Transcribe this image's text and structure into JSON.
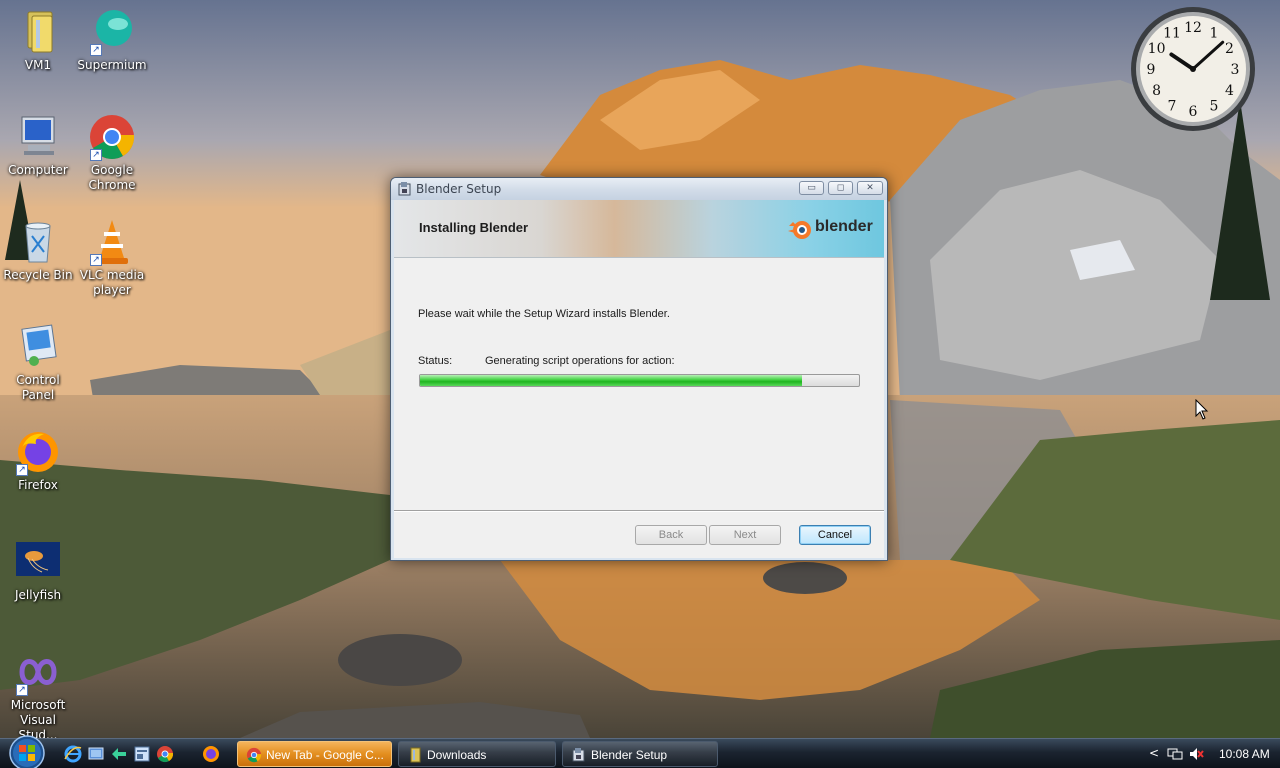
{
  "desktop": {
    "icons": [
      {
        "label": "VM1",
        "icon": "folder-icon"
      },
      {
        "label": "Supermium",
        "icon": "supermium-icon"
      },
      {
        "label": "Computer",
        "icon": "computer-icon"
      },
      {
        "label": "Google Chrome",
        "icon": "chrome-icon"
      },
      {
        "label": "Recycle Bin",
        "icon": "recycle-bin-icon"
      },
      {
        "label": "VLC media player",
        "icon": "vlc-icon"
      },
      {
        "label": "Control Panel",
        "icon": "control-panel-icon"
      },
      {
        "label": "Firefox",
        "icon": "firefox-icon"
      },
      {
        "label": "Jellyfish",
        "icon": "jellyfish-icon"
      },
      {
        "label": "Microsoft Visual Stud...",
        "icon": "visual-studio-icon"
      }
    ]
  },
  "clock": {
    "numbers": [
      "12",
      "1",
      "2",
      "3",
      "4",
      "5",
      "6",
      "7",
      "8",
      "9",
      "10",
      "11"
    ],
    "time_hour": 10,
    "time_minute": 8
  },
  "window": {
    "title": "Blender Setup",
    "banner_title": "Installing Blender",
    "logo_text": "blender",
    "wait_text": "Please wait while the Setup Wizard installs Blender.",
    "status_label": "Status:",
    "status_value": "Generating script operations for action:",
    "progress_fraction": 0.87,
    "buttons": {
      "back": "Back",
      "next": "Next",
      "cancel": "Cancel"
    },
    "caption_buttons": {
      "minimize": "▭",
      "maximize": "◻",
      "close": "✕"
    }
  },
  "taskbar": {
    "quick_launch": [
      "ie-icon",
      "show-desktop-icon",
      "switch-windows-icon",
      "explorer-icon",
      "chrome-icon",
      "firefox-icon"
    ],
    "tasks": {
      "chrome": "New Tab - Google C...",
      "downloads": "Downloads",
      "setup": "Blender Setup"
    },
    "tray": {
      "chevron": "<",
      "time": "10:08 AM"
    }
  },
  "colors": {
    "accent_taskbar_active": "#e38e1f",
    "progress_green": "#1fb51f",
    "cancel_focus": "#3c7fb1"
  }
}
